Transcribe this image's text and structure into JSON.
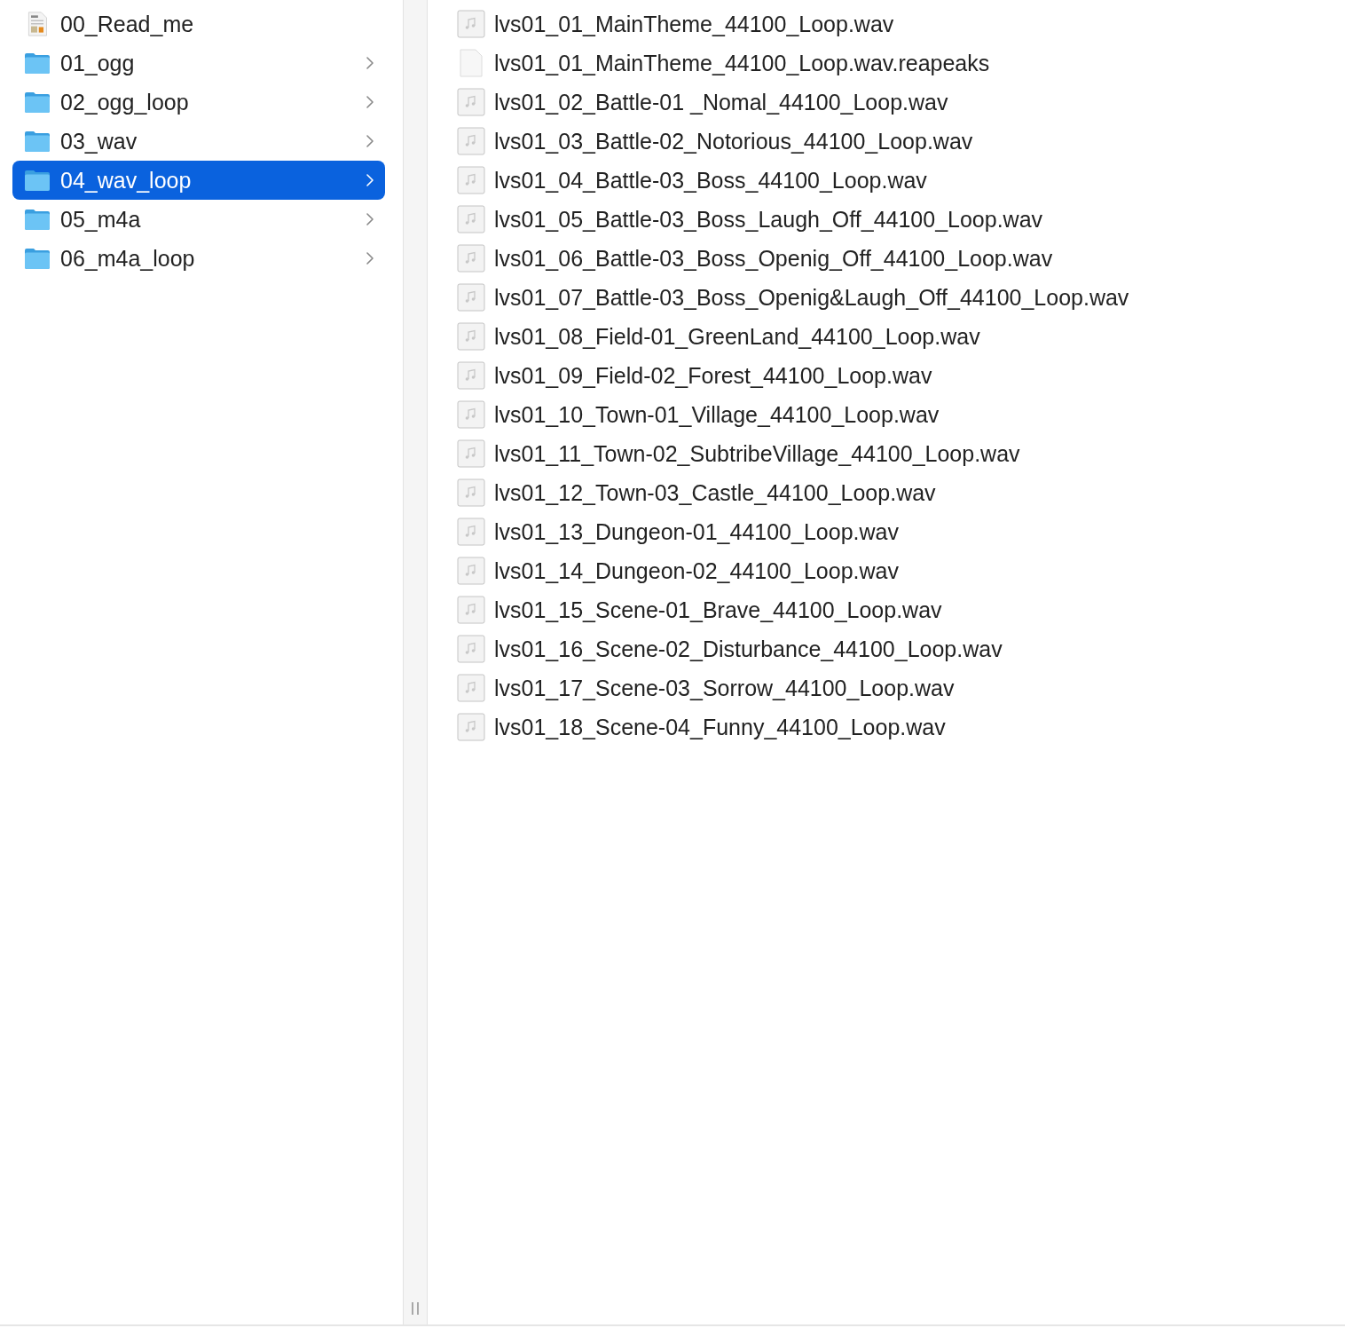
{
  "folders": [
    {
      "name": "00_Read_me",
      "kind": "document",
      "selected": false
    },
    {
      "name": "01_ogg",
      "kind": "folder",
      "selected": false
    },
    {
      "name": "02_ogg_loop",
      "kind": "folder",
      "selected": false
    },
    {
      "name": "03_wav",
      "kind": "folder",
      "selected": false
    },
    {
      "name": "04_wav_loop",
      "kind": "folder",
      "selected": true
    },
    {
      "name": "05_m4a",
      "kind": "folder",
      "selected": false
    },
    {
      "name": "06_m4a_loop",
      "kind": "folder",
      "selected": false
    }
  ],
  "files": [
    {
      "name": "lvs01_01_MainTheme_44100_Loop.wav",
      "kind": "audio"
    },
    {
      "name": "lvs01_01_MainTheme_44100_Loop.wav.reapeaks",
      "kind": "generic"
    },
    {
      "name": "lvs01_02_Battle-01 _Nomal_44100_Loop.wav",
      "kind": "audio"
    },
    {
      "name": "lvs01_03_Battle-02_Notorious_44100_Loop.wav",
      "kind": "audio"
    },
    {
      "name": "lvs01_04_Battle-03_Boss_44100_Loop.wav",
      "kind": "audio"
    },
    {
      "name": "lvs01_05_Battle-03_Boss_Laugh_Off_44100_Loop.wav",
      "kind": "audio"
    },
    {
      "name": "lvs01_06_Battle-03_Boss_Openig_Off_44100_Loop.wav",
      "kind": "audio"
    },
    {
      "name": "lvs01_07_Battle-03_Boss_Openig&Laugh_Off_44100_Loop.wav",
      "kind": "audio"
    },
    {
      "name": "lvs01_08_Field-01_GreenLand_44100_Loop.wav",
      "kind": "audio"
    },
    {
      "name": "lvs01_09_Field-02_Forest_44100_Loop.wav",
      "kind": "audio"
    },
    {
      "name": "lvs01_10_Town-01_Village_44100_Loop.wav",
      "kind": "audio"
    },
    {
      "name": "lvs01_11_Town-02_SubtribeVillage_44100_Loop.wav",
      "kind": "audio"
    },
    {
      "name": "lvs01_12_Town-03_Castle_44100_Loop.wav",
      "kind": "audio"
    },
    {
      "name": "lvs01_13_Dungeon-01_44100_Loop.wav",
      "kind": "audio"
    },
    {
      "name": "lvs01_14_Dungeon-02_44100_Loop.wav",
      "kind": "audio"
    },
    {
      "name": "lvs01_15_Scene-01_Brave_44100_Loop.wav",
      "kind": "audio"
    },
    {
      "name": "lvs01_16_Scene-02_Disturbance_44100_Loop.wav",
      "kind": "audio"
    },
    {
      "name": "lvs01_17_Scene-03_Sorrow_44100_Loop.wav",
      "kind": "audio"
    },
    {
      "name": "lvs01_18_Scene-04_Funny_44100_Loop.wav",
      "kind": "audio"
    }
  ]
}
